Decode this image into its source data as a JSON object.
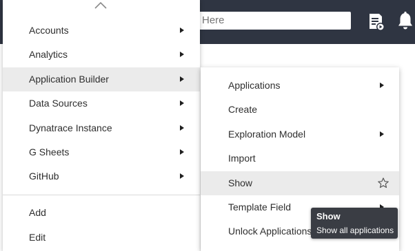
{
  "header": {
    "search": {
      "value": "",
      "placeholder": "Here"
    },
    "icons": [
      "report-icon",
      "bell-icon"
    ],
    "background_color": "#2f3542"
  },
  "main_menu": {
    "caret_icon": "chevron-up-icon",
    "items": [
      {
        "label": "Accounts",
        "has_submenu": true
      },
      {
        "label": "Analytics",
        "has_submenu": true
      },
      {
        "label": "Application Builder",
        "has_submenu": true,
        "active": true
      },
      {
        "label": "Data Sources",
        "has_submenu": true
      },
      {
        "label": "Dynatrace Instance",
        "has_submenu": true
      },
      {
        "label": "G Sheets",
        "has_submenu": true
      },
      {
        "label": "GitHub",
        "has_submenu": true
      }
    ],
    "actions": [
      {
        "label": "Add"
      },
      {
        "label": "Edit"
      }
    ]
  },
  "submenu": {
    "items": [
      {
        "label": "Applications",
        "has_submenu": true
      },
      {
        "label": "Create",
        "has_submenu": false
      },
      {
        "label": "Exploration Model",
        "has_submenu": true
      },
      {
        "label": "Import",
        "has_submenu": false
      },
      {
        "label": "Show",
        "has_submenu": false,
        "active": true,
        "favorite_icon": "star-icon"
      },
      {
        "label": "Template Field",
        "has_submenu": true
      },
      {
        "label": "Unlock Applications",
        "has_submenu": false
      }
    ]
  },
  "tooltip": {
    "title": "Show",
    "description": "Show all applications"
  },
  "colors": {
    "hover_background": "#ebebeb",
    "tooltip_background": "#3a3d44"
  }
}
